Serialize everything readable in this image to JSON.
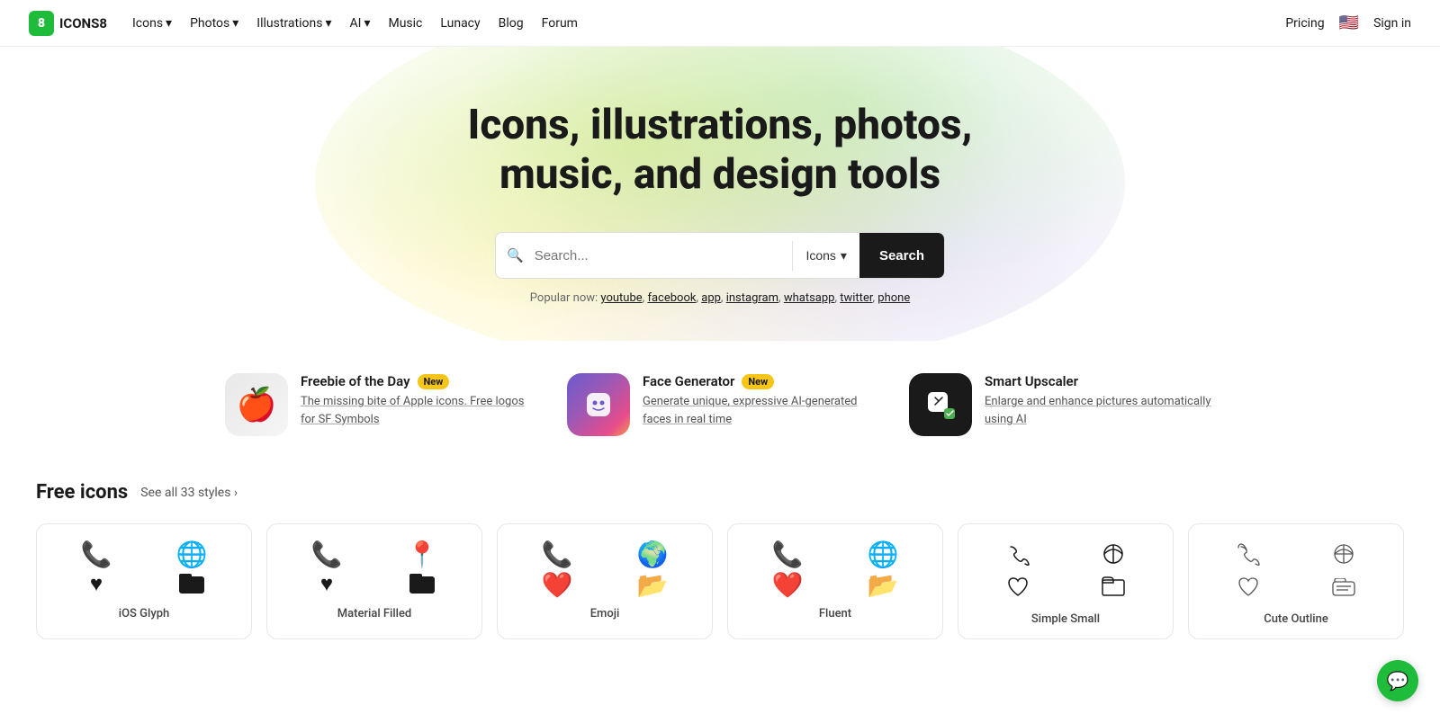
{
  "logo": {
    "icon_text": "8",
    "brand": "ICONS8"
  },
  "nav": {
    "items": [
      {
        "label": "Icons",
        "has_dropdown": true
      },
      {
        "label": "Photos",
        "has_dropdown": true
      },
      {
        "label": "Illustrations",
        "has_dropdown": true
      },
      {
        "label": "AI",
        "has_dropdown": true
      },
      {
        "label": "Music",
        "has_dropdown": false
      },
      {
        "label": "Lunacy",
        "has_dropdown": false
      },
      {
        "label": "Blog",
        "has_dropdown": false
      },
      {
        "label": "Forum",
        "has_dropdown": false
      }
    ],
    "right": {
      "pricing": "Pricing",
      "sign_in": "Sign in"
    }
  },
  "hero": {
    "title_line1": "Icons, illustrations, photos,",
    "title_line2": "music, and design tools",
    "search": {
      "placeholder": "Search...",
      "type_label": "Icons",
      "button_label": "Search"
    },
    "popular": {
      "prefix": "Popular now:",
      "links": [
        "youtube",
        "facebook",
        "app",
        "instagram",
        "whatsapp",
        "twitter",
        "phone"
      ]
    }
  },
  "feature_cards": [
    {
      "title": "Freebie of the Day",
      "badge": "New",
      "description": "The missing bite of Apple icons. Free logos for SF Symbols"
    },
    {
      "title": "Face Generator",
      "badge": "New",
      "description": "Generate unique, expressive AI-generated faces in real time"
    },
    {
      "title": "Smart Upscaler",
      "badge": null,
      "description": "Enlarge and enhance pictures automatically using AI"
    }
  ],
  "free_icons": {
    "section_title": "Free icons",
    "see_all_link": "See all 33 styles ›",
    "styles": [
      {
        "name": "iOS Glyph",
        "icons": [
          "📞",
          "🌐",
          "🖤",
          "📁"
        ]
      },
      {
        "name": "Material Filled",
        "icons": [
          "📞",
          "📍",
          "🖤",
          "📁"
        ]
      },
      {
        "name": "Emoji",
        "icons": [
          "📞",
          "🌍",
          "❤️",
          "📂"
        ]
      },
      {
        "name": "Fluent",
        "icons": [
          "📞",
          "🌐",
          "❤️",
          "📂"
        ]
      },
      {
        "name": "Simple Small",
        "icons": [
          "📞",
          "🌐",
          "🤍",
          "📁"
        ]
      },
      {
        "name": "Cute Outline",
        "icons": [
          "📞",
          "🌐",
          "🤍",
          "🎟️"
        ]
      }
    ]
  },
  "chat_button": {
    "icon": "💬"
  }
}
